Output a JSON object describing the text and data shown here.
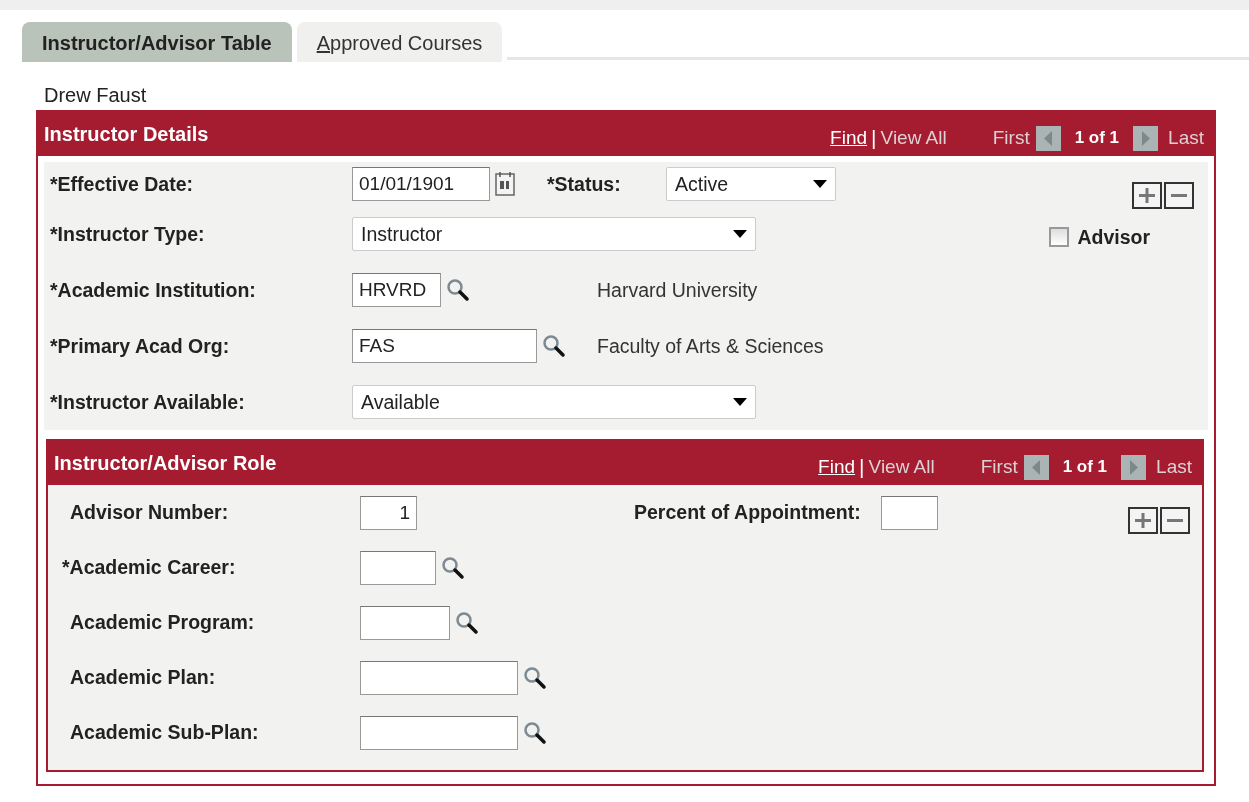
{
  "tabs": [
    {
      "label": "Instructor/Advisor Table",
      "selected": true
    },
    {
      "label": "Approved Courses",
      "selected": false
    }
  ],
  "person_name": "Drew Faust",
  "instructor_details": {
    "title": "Instructor Details",
    "pager": {
      "find": "Find",
      "separator": "|",
      "view_all": "View All",
      "first": "First",
      "count": "1 of 1",
      "last": "Last"
    },
    "effective_date": {
      "label": "*Effective Date:",
      "value": "01/01/1901"
    },
    "status": {
      "label": "*Status:",
      "value": "Active"
    },
    "instructor_type": {
      "label": "*Instructor Type:",
      "value": "Instructor"
    },
    "advisor": {
      "label": "Advisor",
      "checked": false
    },
    "academic_institution": {
      "label": "*Academic Institution:",
      "value": "HRVRD",
      "description": "Harvard University"
    },
    "primary_acad_org": {
      "label": "*Primary Acad Org:",
      "value": "FAS",
      "description": "Faculty of Arts & Sciences"
    },
    "instructor_available": {
      "label": "*Instructor Available:",
      "value": "Available"
    }
  },
  "instructor_advisor_role": {
    "title": "Instructor/Advisor Role",
    "pager": {
      "find": "Find",
      "separator": "|",
      "view_all": "View All",
      "first": "First",
      "count": "1 of 1",
      "last": "Last"
    },
    "advisor_number": {
      "label": "Advisor Number:",
      "value": "1"
    },
    "percent_of_appointment": {
      "label": "Percent of Appointment:"
    },
    "prompts": [
      {
        "label": "*Academic Career:"
      },
      {
        "label": "Academic Program:"
      },
      {
        "label": "Academic Plan:"
      },
      {
        "label": "Academic Sub-Plan:"
      }
    ]
  }
}
